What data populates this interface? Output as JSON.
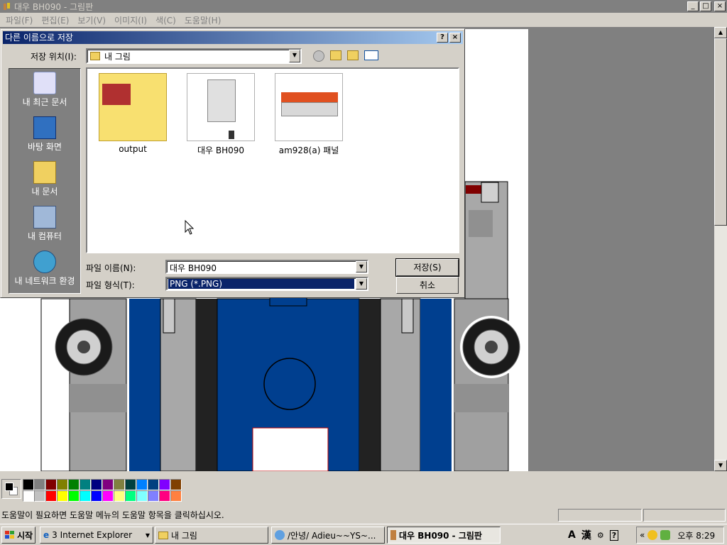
{
  "window": {
    "title": "대우 BH090 - 그림판",
    "controls": [
      "_",
      "□",
      "×"
    ]
  },
  "menu": [
    "파일(F)",
    "편집(E)",
    "보기(V)",
    "이미지(I)",
    "색(C)",
    "도움말(H)"
  ],
  "dialog": {
    "title": "다른 이름으로 저장",
    "help_btn": "?",
    "close_btn": "×",
    "location_label": "저장 위치(I):",
    "location_value": "내 그림",
    "places": [
      "내 최근 문서",
      "바탕 화면",
      "내 문서",
      "내 컴퓨터",
      "내 네트워크 환경"
    ],
    "files": [
      {
        "name": "output",
        "icon": "folder-icon"
      },
      {
        "name": "대우 BH090",
        "icon": "image-thumbnail"
      },
      {
        "name": "am928(a) 패널",
        "icon": "image-thumbnail"
      }
    ],
    "filename_label": "파일 이름(N):",
    "filename_value": "대우 BH090",
    "filetype_label": "파일 형식(T):",
    "filetype_value": "PNG (*.PNG)",
    "save_btn": "저장(S)",
    "cancel_btn": "취소"
  },
  "palette": {
    "foreground": "#000000",
    "background": "#ffffff",
    "colors": [
      "#000000",
      "#808080",
      "#800000",
      "#808000",
      "#008000",
      "#008080",
      "#000080",
      "#800080",
      "#808040",
      "#004040",
      "#0080ff",
      "#004080",
      "#8000ff",
      "#804000",
      "#ffffff",
      "#c0c0c0",
      "#ff0000",
      "#ffff00",
      "#00ff00",
      "#00ffff",
      "#0000ff",
      "#ff00ff",
      "#ffff80",
      "#00ff80",
      "#80ffff",
      "#8080ff",
      "#ff0080",
      "#ff8040"
    ]
  },
  "status": {
    "text": "도움말이 필요하면 도움말 메뉴의 도움말 항목을 클릭하십시오."
  },
  "taskbar": {
    "start": "시작",
    "tasks": [
      {
        "label": "3 Internet Explorer",
        "icon": "ie-icon"
      },
      {
        "label": "내 그림",
        "icon": "folder-icon"
      },
      {
        "label": "/안녕/ Adieu~~YS~...",
        "icon": "messenger-icon"
      },
      {
        "label": "대우 BH090 - 그림판",
        "icon": "paint-icon"
      }
    ],
    "ime": [
      "A",
      "漢"
    ],
    "tray_arrow": "«",
    "clock": "오후 8:29"
  },
  "colors": {
    "title_inactive": "#808080",
    "dialog_title": "#0a246a",
    "bus_blue": "#003f8f",
    "bus_gray": "#a0a0a0"
  }
}
